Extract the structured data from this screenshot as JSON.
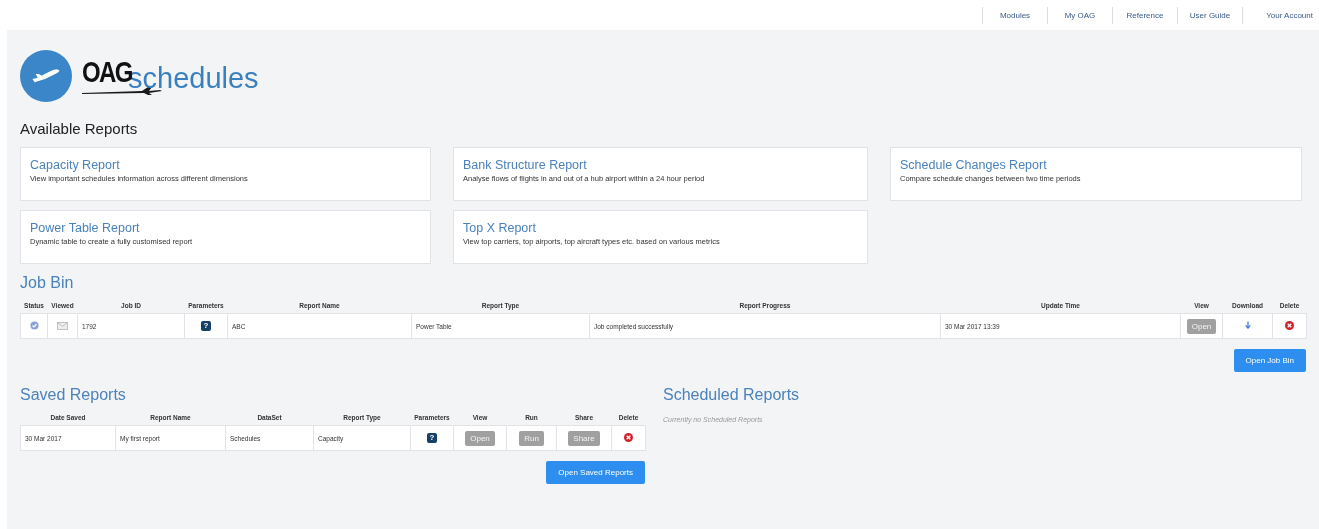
{
  "top_nav": [
    "Modules",
    "My OAG",
    "Reference",
    "User Guide",
    "Your Account"
  ],
  "logo": {
    "brand": "OAG",
    "product": "schedules"
  },
  "available_reports": {
    "title": "Available Reports",
    "cards": [
      {
        "title": "Capacity Report",
        "description": "View important schedules information across different dimensions"
      },
      {
        "title": "Bank Structure Report",
        "description": "Analyse flows of flights in and out of a hub airport within a 24 hour period"
      },
      {
        "title": "Schedule Changes Report",
        "description": "Compare schedule changes between two time periods"
      },
      {
        "title": "Power Table Report",
        "description": "Dynamic table to create a fully customised report"
      },
      {
        "title": "Top X Report",
        "description": "View top carriers, top airports, top aircraft types etc. based on various metrics"
      }
    ]
  },
  "job_bin": {
    "title": "Job Bin",
    "columns": [
      "Status",
      "Viewed",
      "Job ID",
      "Parameters",
      "Report Name",
      "Report Type",
      "Report Progress",
      "Update Time",
      "View",
      "Download",
      "Delete"
    ],
    "rows": [
      [
        {
          "kind": "status"
        },
        {
          "kind": "viewed"
        },
        {
          "kind": "text",
          "text": "1792"
        },
        {
          "kind": "help",
          "text": "?"
        },
        {
          "kind": "text",
          "text": "ABC"
        },
        {
          "kind": "text",
          "text": "Power Table"
        },
        {
          "kind": "text",
          "text": "Job completed successfully"
        },
        {
          "kind": "text",
          "text": "30 Mar 2017 13:39"
        },
        {
          "kind": "button",
          "text": "Open"
        },
        {
          "kind": "download"
        },
        {
          "kind": "delete"
        }
      ]
    ],
    "button": "Open Job Bin"
  },
  "saved_reports": {
    "title": "Saved Reports",
    "columns": [
      "Date Saved",
      "Report Name",
      "DataSet",
      "Report Type",
      "Parameters",
      "View",
      "Run",
      "Share",
      "Delete"
    ],
    "rows": [
      [
        {
          "kind": "text",
          "text": "30 Mar 2017"
        },
        {
          "kind": "text",
          "text": "My first report"
        },
        {
          "kind": "text",
          "text": "Schedules"
        },
        {
          "kind": "text",
          "text": "Capacity"
        },
        {
          "kind": "help",
          "text": "?"
        },
        {
          "kind": "button",
          "text": "Open"
        },
        {
          "kind": "button",
          "text": "Run"
        },
        {
          "kind": "button",
          "text": "Share"
        },
        {
          "kind": "delete"
        }
      ]
    ],
    "button": "Open Saved Reports"
  },
  "scheduled_reports": {
    "title": "Scheduled Reports",
    "empty_message": "Currently no Scheduled Reports"
  }
}
